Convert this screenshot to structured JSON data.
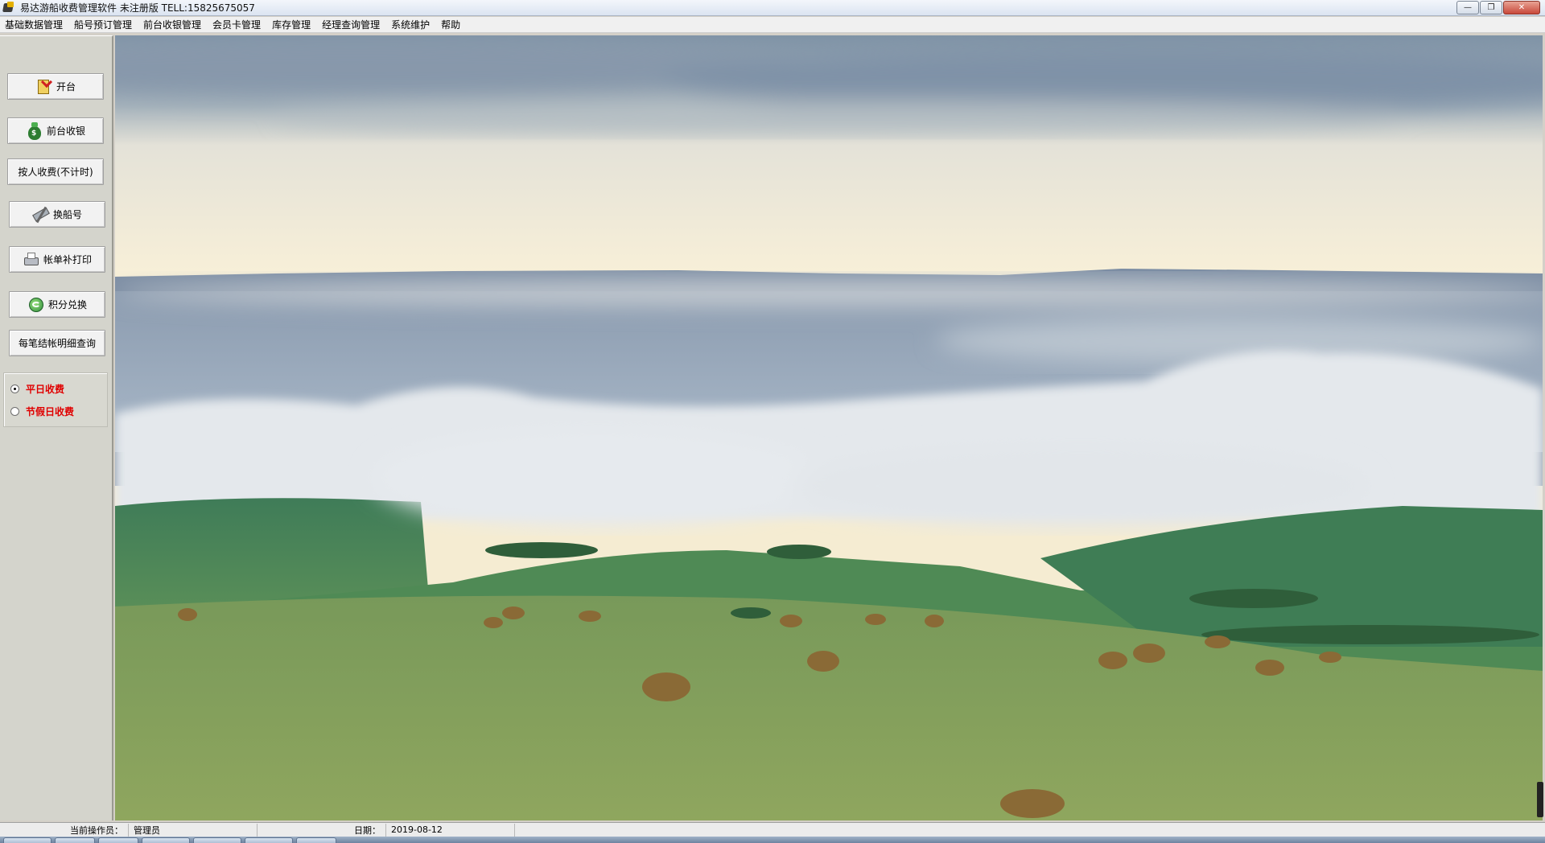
{
  "window": {
    "title": "易达游船收费管理软件 未注册版  TELL:15825675057",
    "buttons": {
      "minimize": "—",
      "maximize": "❐",
      "close": "✕"
    }
  },
  "menu": {
    "items": [
      "基础数据管理",
      "船号预订管理",
      "前台收银管理",
      "会员卡管理",
      "库存管理",
      "经理查询管理",
      "系统维护",
      "帮助"
    ]
  },
  "sidebar": {
    "buttons": [
      {
        "label": "开台",
        "icon": "open-table-icon"
      },
      {
        "label": "前台收银",
        "icon": "money-bag-icon"
      },
      {
        "label": "按人收费(不计时)",
        "icon": ""
      },
      {
        "label": "换船号",
        "icon": "boat-swap-icon"
      },
      {
        "label": "帐单补打印",
        "icon": "printer-icon"
      },
      {
        "label": "积分兑换",
        "icon": "points-exchange-icon"
      },
      {
        "label": "每笔结帐明细查询",
        "icon": ""
      }
    ],
    "fee_mode": {
      "options": [
        {
          "label": "平日收费",
          "checked": true
        },
        {
          "label": "节假日收费",
          "checked": false
        }
      ],
      "color": "#e00000"
    }
  },
  "main": {
    "background": "landscape-wallpaper"
  },
  "statusbar": {
    "operator_label": "当前操作员：",
    "operator_value": "管理员",
    "date_label": "日期：",
    "date_value": "2019-08-12"
  }
}
